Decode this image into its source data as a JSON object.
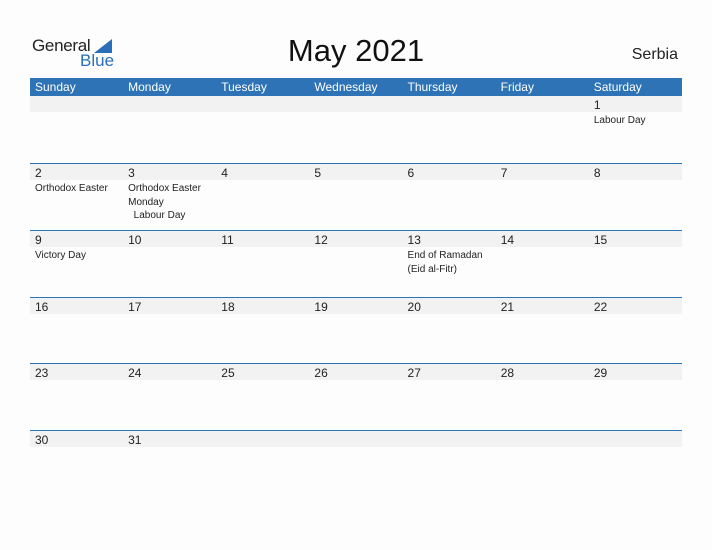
{
  "logo": {
    "word1": "General",
    "word2": "Blue"
  },
  "title": "May 2021",
  "country": "Serbia",
  "colors": {
    "accent": "#2d73b5",
    "band": "#f2f2f2"
  },
  "weekdays": [
    "Sunday",
    "Monday",
    "Tuesday",
    "Wednesday",
    "Thursday",
    "Friday",
    "Saturday"
  ],
  "weeks": [
    [
      {
        "day": "",
        "events": ""
      },
      {
        "day": "",
        "events": ""
      },
      {
        "day": "",
        "events": ""
      },
      {
        "day": "",
        "events": ""
      },
      {
        "day": "",
        "events": ""
      },
      {
        "day": "",
        "events": ""
      },
      {
        "day": "1",
        "events": "Labour Day"
      }
    ],
    [
      {
        "day": "2",
        "events": "Orthodox Easter"
      },
      {
        "day": "3",
        "events": "Orthodox Easter\nMonday\n  Labour Day"
      },
      {
        "day": "4",
        "events": ""
      },
      {
        "day": "5",
        "events": ""
      },
      {
        "day": "6",
        "events": ""
      },
      {
        "day": "7",
        "events": ""
      },
      {
        "day": "8",
        "events": ""
      }
    ],
    [
      {
        "day": "9",
        "events": "Victory Day"
      },
      {
        "day": "10",
        "events": ""
      },
      {
        "day": "11",
        "events": ""
      },
      {
        "day": "12",
        "events": ""
      },
      {
        "day": "13",
        "events": "End of Ramadan\n(Eid al-Fitr)"
      },
      {
        "day": "14",
        "events": ""
      },
      {
        "day": "15",
        "events": ""
      }
    ],
    [
      {
        "day": "16",
        "events": ""
      },
      {
        "day": "17",
        "events": ""
      },
      {
        "day": "18",
        "events": ""
      },
      {
        "day": "19",
        "events": ""
      },
      {
        "day": "20",
        "events": ""
      },
      {
        "day": "21",
        "events": ""
      },
      {
        "day": "22",
        "events": ""
      }
    ],
    [
      {
        "day": "23",
        "events": ""
      },
      {
        "day": "24",
        "events": ""
      },
      {
        "day": "25",
        "events": ""
      },
      {
        "day": "26",
        "events": ""
      },
      {
        "day": "27",
        "events": ""
      },
      {
        "day": "28",
        "events": ""
      },
      {
        "day": "29",
        "events": ""
      }
    ],
    [
      {
        "day": "30",
        "events": ""
      },
      {
        "day": "31",
        "events": ""
      },
      {
        "day": "",
        "events": ""
      },
      {
        "day": "",
        "events": ""
      },
      {
        "day": "",
        "events": ""
      },
      {
        "day": "",
        "events": ""
      },
      {
        "day": "",
        "events": ""
      }
    ]
  ]
}
